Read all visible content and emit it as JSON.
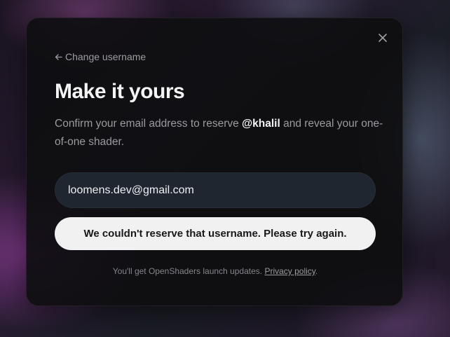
{
  "modal": {
    "back_label": "Change username",
    "title": "Make it yours",
    "subtitle_before": "Confirm your email address to reserve ",
    "subtitle_handle": "@khalil",
    "subtitle_after": " and reveal your one-of-one shader.",
    "email_value": "loomens.dev@gmail.com",
    "submit_label": "We couldn't reserve that username. Please try again.",
    "footer_text": "You'll get OpenShaders launch updates. ",
    "privacy_label": "Privacy policy",
    "footer_period": "."
  },
  "icons": {
    "close": "close-icon",
    "back": "arrow-left-icon"
  }
}
